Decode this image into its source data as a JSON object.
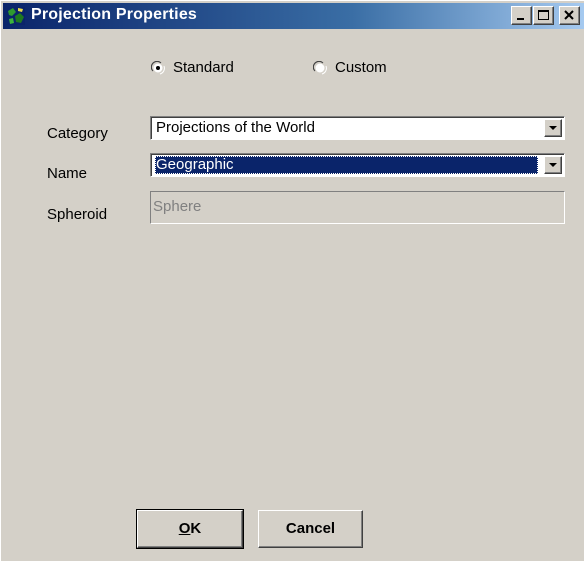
{
  "window": {
    "title": "Projection Properties",
    "title_gradient": [
      "#0a246a",
      "#a6caf0"
    ],
    "controls": {
      "minimize": "minimize-icon",
      "maximize": "maximize-icon",
      "close": "close-icon"
    }
  },
  "mode": {
    "options": [
      {
        "label": "Standard",
        "selected": true
      },
      {
        "label": "Custom",
        "selected": false
      }
    ]
  },
  "fields": {
    "category": {
      "label": "Category",
      "value": "Projections of the World"
    },
    "name": {
      "label": "Name",
      "value": "Geographic"
    },
    "spheroid": {
      "label": "Spheroid",
      "value": "Sphere",
      "disabled": true
    }
  },
  "buttons": {
    "ok_mnemonic": "O",
    "ok_rest": "K",
    "cancel": "Cancel"
  },
  "colors": {
    "face": "#d4d0c8",
    "selection": "#0a246a",
    "disabled_text": "#808080"
  }
}
